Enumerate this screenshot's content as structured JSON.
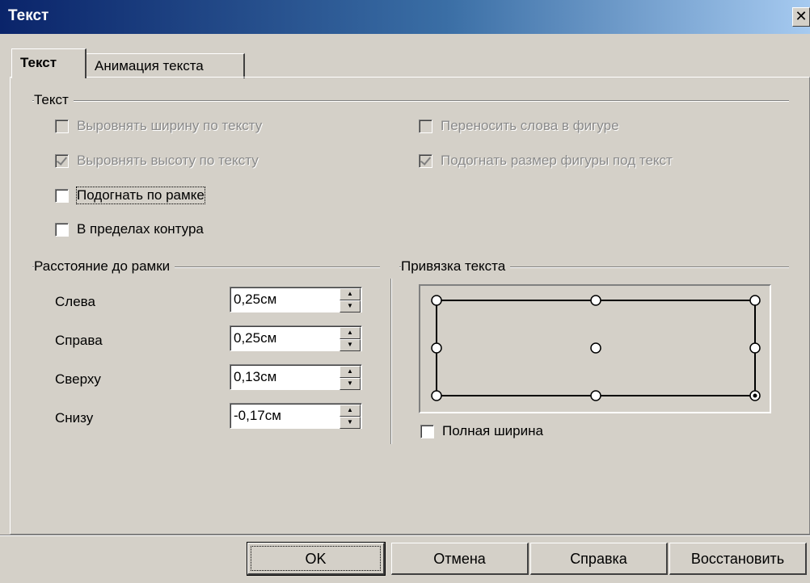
{
  "window": {
    "title": "Текст",
    "close_glyph": "✕"
  },
  "tabs": [
    {
      "label": "Текст",
      "active": true
    },
    {
      "label": "Анимация текста",
      "active": false
    }
  ],
  "text_group": {
    "label": "Текст",
    "options": [
      {
        "label": "Выровнять ширину по тексту",
        "checked": false,
        "enabled": false
      },
      {
        "label": "Выровнять высоту по тексту",
        "checked": true,
        "enabled": false
      },
      {
        "label": "Подогнать по рамке",
        "checked": false,
        "enabled": true
      },
      {
        "label": "В пределах контура",
        "checked": false,
        "enabled": true
      },
      {
        "label": "Переносить слова в фигуре",
        "checked": false,
        "enabled": false
      },
      {
        "label": "Подогнать размер фигуры под текст",
        "checked": true,
        "enabled": false
      }
    ]
  },
  "spacing_group": {
    "label": "Расстояние до рамки",
    "fields": [
      {
        "label": "Слева",
        "value": "0,25см"
      },
      {
        "label": "Справа",
        "value": "0,25см"
      },
      {
        "label": "Сверху",
        "value": "0,13см"
      },
      {
        "label": "Снизу",
        "value": "-0,17см"
      }
    ]
  },
  "anchor_group": {
    "label": "Привязка текста",
    "selected": "bottom-right",
    "full_width_label": "Полная ширина",
    "full_width_checked": false
  },
  "buttons": {
    "ok": "OK",
    "cancel": "Отмена",
    "help": "Справка",
    "reset": "Восстановить"
  },
  "colors": {
    "title_start": "#0a246a",
    "title_end": "#a6caf0",
    "face": "#d4d0c8"
  }
}
